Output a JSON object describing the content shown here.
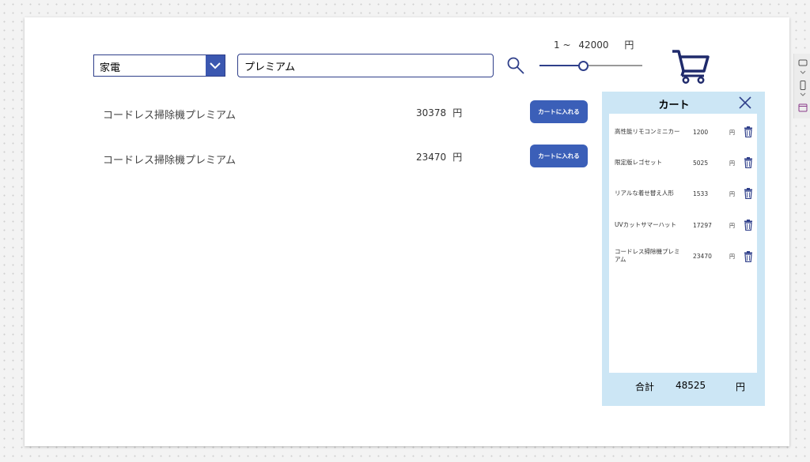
{
  "filters": {
    "category": "家電",
    "search_value": "プレミアム",
    "price_min_label": "1 ~",
    "price_max": "42000",
    "price_unit": "円",
    "slider_level_pct": 42
  },
  "products": [
    {
      "name": "コードレス掃除機プレミアム",
      "price": "30378",
      "unit": "円",
      "button": "カートに入れる"
    },
    {
      "name": "コードレス掃除機プレミアム",
      "price": "23470",
      "unit": "円",
      "button": "カートに入れる"
    }
  ],
  "cart": {
    "title": "カート",
    "items": [
      {
        "name": "高性能リモコンミニカー",
        "price": "1200",
        "unit": "円"
      },
      {
        "name": "限定版レゴセット",
        "price": "5025",
        "unit": "円"
      },
      {
        "name": "リアルな着せ替え人形",
        "price": "1533",
        "unit": "円"
      },
      {
        "name": "UVカットサマーハット",
        "price": "17297",
        "unit": "円"
      },
      {
        "name": "コードレス掃除機プレミアム",
        "price": "23470",
        "unit": "円"
      }
    ],
    "total_label": "合計",
    "total_value": "48525",
    "total_unit": "円"
  },
  "colors": {
    "accent": "#3b5fb8",
    "navy": "#2f3f8a",
    "cart_bg": "#cce6f5"
  }
}
